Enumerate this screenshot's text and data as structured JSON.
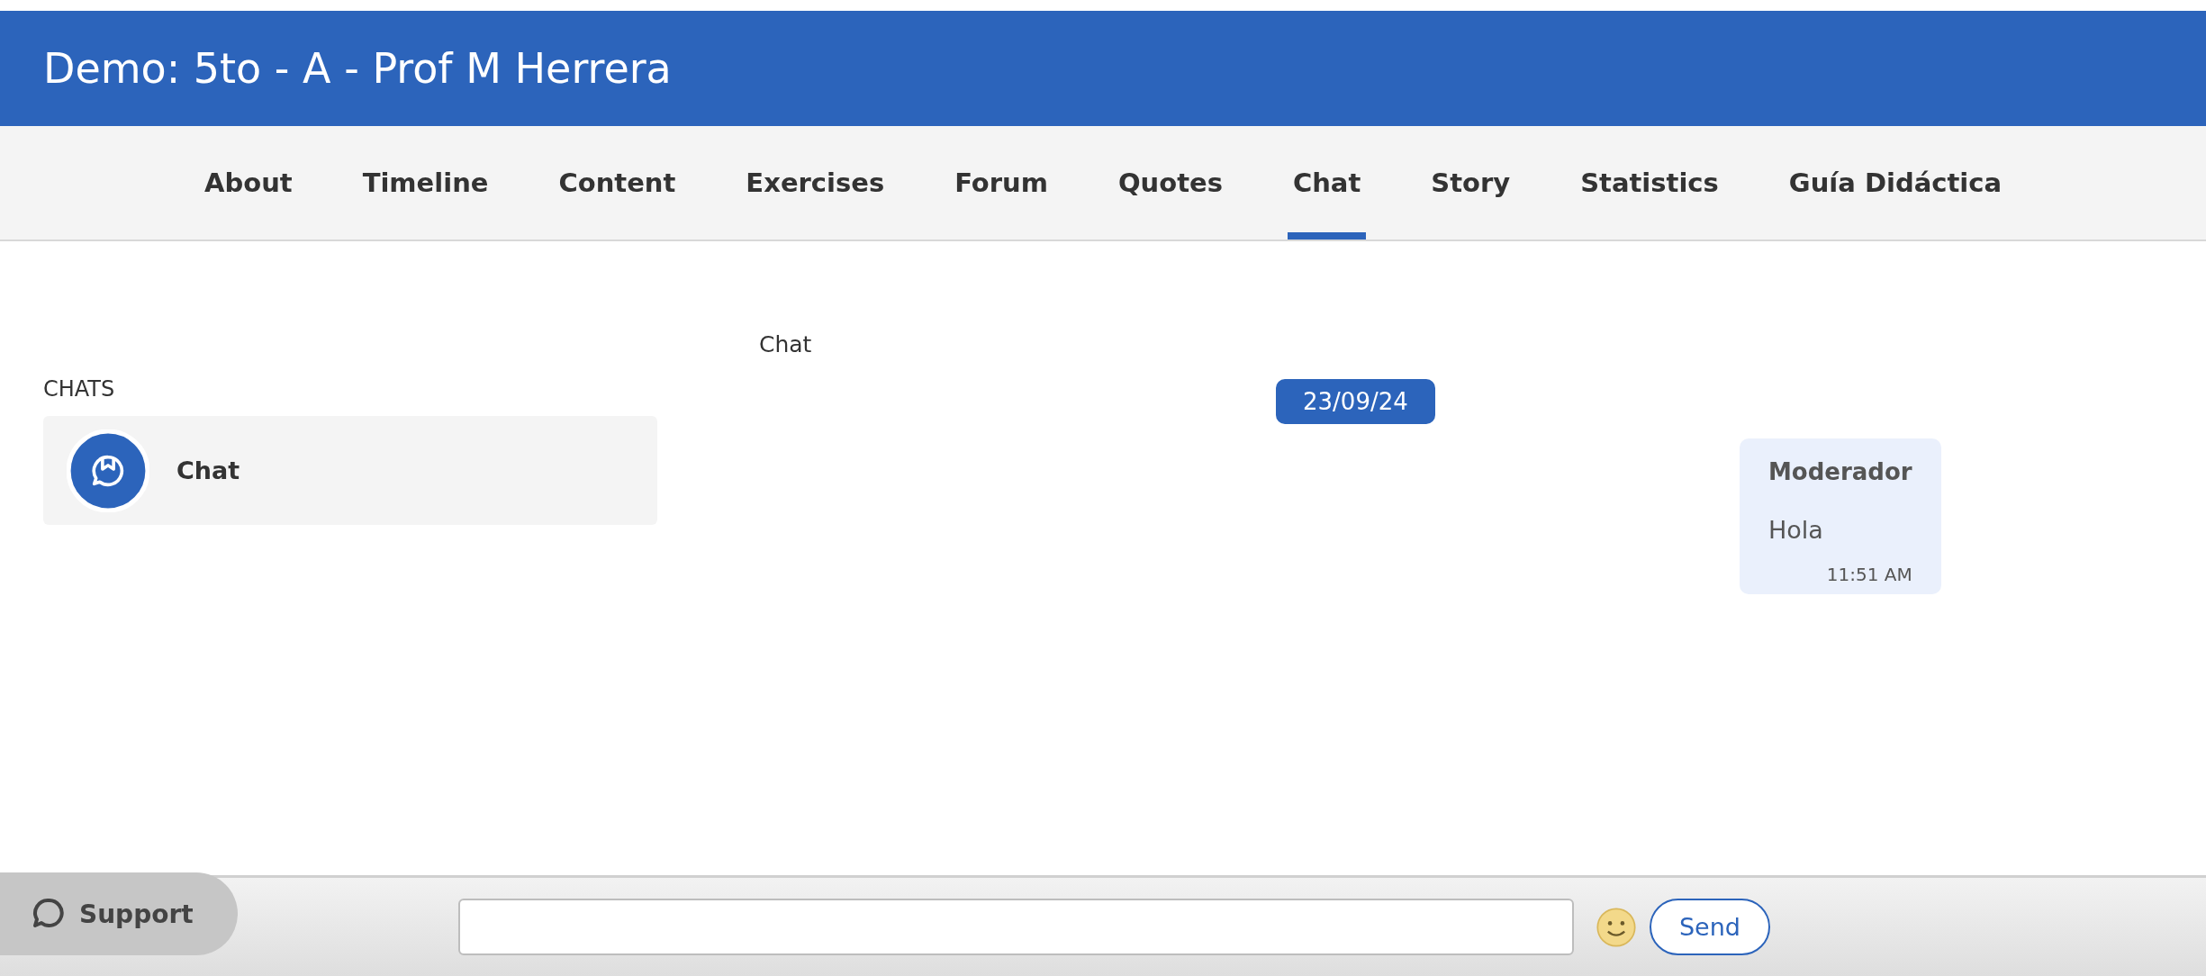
{
  "header": {
    "title": "Demo: 5to - A - Prof M Herrera"
  },
  "tabs": [
    {
      "label": "About",
      "selected": false
    },
    {
      "label": "Timeline",
      "selected": false
    },
    {
      "label": "Content",
      "selected": false
    },
    {
      "label": "Exercises",
      "selected": false
    },
    {
      "label": "Forum",
      "selected": false
    },
    {
      "label": "Quotes",
      "selected": false
    },
    {
      "label": "Chat",
      "selected": true
    },
    {
      "label": "Story",
      "selected": false
    },
    {
      "label": "Statistics",
      "selected": false
    },
    {
      "label": "Guía Didáctica",
      "selected": false
    }
  ],
  "sidebar": {
    "heading": "CHATS",
    "items": [
      {
        "name": "Chat"
      }
    ]
  },
  "conversation": {
    "title": "Chat",
    "date": "23/09/24",
    "messages": [
      {
        "sender": "Moderador",
        "text": "Hola",
        "time": "11:51 AM"
      }
    ]
  },
  "composer": {
    "send": "Send"
  },
  "support_button": {
    "label": "Support"
  }
}
